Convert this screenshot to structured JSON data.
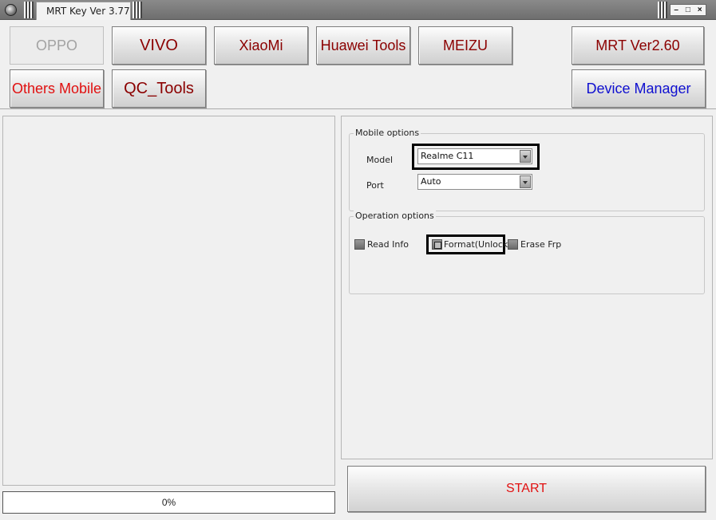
{
  "window": {
    "title": "MRT Key Ver 3.77",
    "controls": [
      "–",
      "□",
      "×"
    ]
  },
  "brands": {
    "oppo": "OPPO",
    "vivo": "VIVO",
    "xiaomi": "XiaoMi",
    "huawei": "Huawei Tools",
    "meizu": "MEIZU",
    "mrt": "MRT Ver2.60",
    "others": "Others Mobile",
    "qc": "QC_Tools",
    "device_manager": "Device Manager"
  },
  "colors": {
    "dark_red": "#8b0000",
    "red": "#e11010",
    "blue": "#1010d0",
    "disabled": "#a3a3a3"
  },
  "mobile_options": {
    "title": "Mobile options",
    "model_label": "Model",
    "model_value": "Realme C11",
    "port_label": "Port",
    "port_value": "Auto"
  },
  "operation_options": {
    "title": "Operation options",
    "read_info": "Read Info",
    "format_unlock": "Format(Unlock)",
    "erase_frp": "Erase Frp"
  },
  "progress": {
    "text": "0%"
  },
  "start_label": "START"
}
